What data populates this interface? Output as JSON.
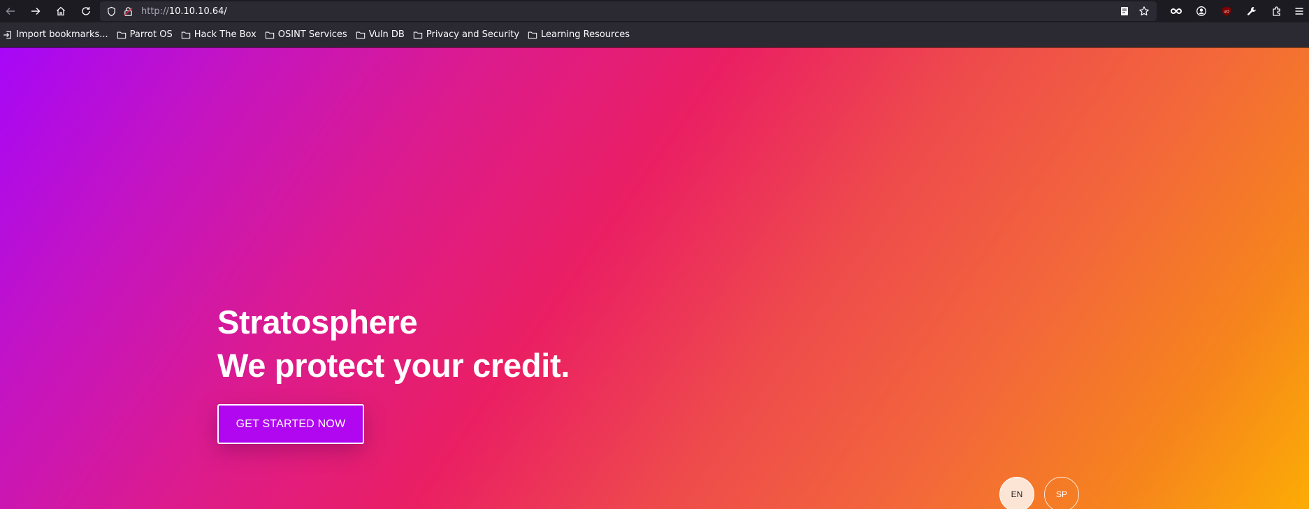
{
  "browser": {
    "url_protocol": "http://",
    "url_host": "10.10.10.64/",
    "icons": {
      "back": "back-arrow-icon",
      "forward": "forward-arrow-icon",
      "home": "home-icon",
      "reload": "reload-icon",
      "tracking_protection": "shield-icon",
      "connection": "lock-insecure-icon",
      "reader": "reader-view-icon",
      "bookmark_star": "star-icon",
      "extensions": [
        "infinity-icon",
        "account-icon",
        "ublock-icon",
        "wrench-icon",
        "extensions-puzzle-icon",
        "hamburger-menu-icon"
      ]
    }
  },
  "bookmarks": [
    {
      "label": "Import bookmarks...",
      "icon": "import-icon"
    },
    {
      "label": "Parrot OS",
      "icon": "folder-icon"
    },
    {
      "label": "Hack The Box",
      "icon": "folder-icon"
    },
    {
      "label": "OSINT Services",
      "icon": "folder-icon"
    },
    {
      "label": "Vuln DB",
      "icon": "folder-icon"
    },
    {
      "label": "Privacy and Security",
      "icon": "folder-icon"
    },
    {
      "label": "Learning Resources",
      "icon": "folder-icon"
    }
  ],
  "hero": {
    "title_line1": "Stratosphere",
    "title_line2": "We protect your credit.",
    "cta_label": "GET STARTED NOW"
  },
  "languages": {
    "en": "EN",
    "sp": "SP",
    "selected": "EN"
  },
  "colors": {
    "gradient_start": "#a607f8",
    "gradient_mid": "#ea1f63",
    "gradient_end": "#fcac05",
    "cta_background": "#b006f0"
  }
}
